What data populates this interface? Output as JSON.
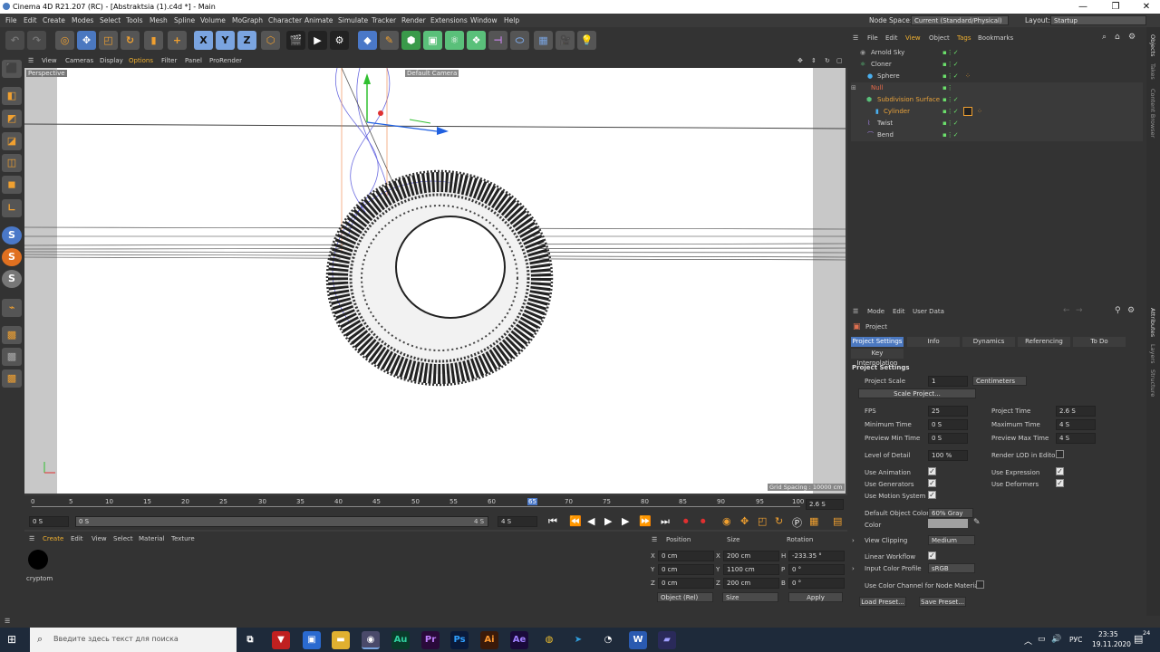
{
  "window": {
    "title": "Cinema 4D R21.207 (RC) - [Abstraktsia (1).c4d *] - Main",
    "minimize": "—",
    "maximize": "❐",
    "close": "✕"
  },
  "menubar": {
    "items": [
      "File",
      "Edit",
      "Create",
      "Modes",
      "Select",
      "Tools",
      "Mesh",
      "Spline",
      "Volume",
      "MoGraph",
      "Character",
      "Animate",
      "Simulate",
      "Tracker",
      "Render",
      "Extensions",
      "Window",
      "Help"
    ],
    "node_space_label": "Node Space:",
    "node_space_value": "Current (Standard/Physical)",
    "layout_label": "Layout:",
    "layout_value": "Startup"
  },
  "toolbar": {
    "axis_x": "X",
    "axis_y": "Y",
    "axis_z": "Z"
  },
  "left_tools": {
    "s1": "S",
    "s2": "S",
    "s3": "S"
  },
  "viewport": {
    "menu": [
      "View",
      "Cameras",
      "Display",
      "Options",
      "Filter",
      "Panel",
      "ProRender"
    ],
    "label": "Perspective",
    "camera": "Default Camera",
    "grid_spacing": "Grid Spacing : 10000 cm"
  },
  "timeline": {
    "ticks": [
      "0",
      "5",
      "10",
      "15",
      "20",
      "25",
      "30",
      "35",
      "40",
      "45",
      "50",
      "55",
      "60",
      "65",
      "70",
      "75",
      "80",
      "85",
      "90",
      "95",
      "100"
    ],
    "current_frame": "2.6 S"
  },
  "transport": {
    "start": "0 S",
    "min": "0 S",
    "max_label": "4 S",
    "end": "4 S"
  },
  "material_manager": {
    "menu": [
      "Create",
      "Edit",
      "View",
      "Select",
      "Material",
      "Texture"
    ],
    "materials": [
      {
        "name": "cryptom"
      }
    ]
  },
  "coord_manager": {
    "headers": {
      "position": "Position",
      "size": "Size",
      "rotation": "Rotation"
    },
    "rows": [
      {
        "axis": "X",
        "pos": "0 cm",
        "saxis": "X",
        "size": "200 cm",
        "raxis": "H",
        "rot": "-233.35 °"
      },
      {
        "axis": "Y",
        "pos": "0 cm",
        "saxis": "Y",
        "size": "1100 cm",
        "raxis": "P",
        "rot": "0 °"
      },
      {
        "axis": "Z",
        "pos": "0 cm",
        "saxis": "Z",
        "size": "200 cm",
        "raxis": "B",
        "rot": "0 °"
      }
    ],
    "mode": "Object (Rel)",
    "size_mode": "Size",
    "apply": "Apply"
  },
  "object_manager": {
    "menu": [
      "File",
      "Edit",
      "View",
      "Object",
      "Tags",
      "Bookmarks"
    ],
    "objects": [
      {
        "name": "Arnold Sky",
        "indent": 0,
        "color": "#cfcfcf"
      },
      {
        "name": "Cloner",
        "indent": 0,
        "color": "#cfcfcf"
      },
      {
        "name": "Sphere",
        "indent": 1,
        "color": "#cfcfcf"
      },
      {
        "name": "Null",
        "indent": 0,
        "color": "#e86a4a"
      },
      {
        "name": "Subdivision Surface",
        "indent": 1,
        "color": "#e8a23a"
      },
      {
        "name": "Cylinder",
        "indent": 2,
        "color": "#e8a23a"
      },
      {
        "name": "Twist",
        "indent": 1,
        "color": "#cfcfcf"
      },
      {
        "name": "Bend",
        "indent": 1,
        "color": "#cfcfcf"
      }
    ]
  },
  "attr_manager": {
    "menu": [
      "Mode",
      "Edit",
      "User Data"
    ],
    "object_name": "Project",
    "tabs": [
      "Project Settings",
      "Info",
      "Dynamics",
      "Referencing",
      "To Do"
    ],
    "tab2": "Key Interpolation",
    "section": "Project Settings",
    "project_scale_label": "Project Scale",
    "project_scale_value": "1",
    "project_scale_unit": "Centimeters",
    "scale_project_btn": "Scale Project...",
    "fps_label": "FPS",
    "fps_value": "25",
    "project_time_label": "Project Time",
    "project_time_value": "2.6 S",
    "min_time_label": "Minimum Time",
    "min_time_value": "0 S",
    "max_time_label": "Maximum Time",
    "max_time_value": "4 S",
    "prev_min_label": "Preview Min Time",
    "prev_min_value": "0 S",
    "prev_max_label": "Preview Max Time",
    "prev_max_value": "4 S",
    "lod_label": "Level of Detail",
    "lod_value": "100 %",
    "render_lod_label": "Render LOD in Editor",
    "use_animation": "Use Animation",
    "use_expression": "Use Expression",
    "use_generators": "Use Generators",
    "use_deformers": "Use Deformers",
    "use_motion": "Use Motion System",
    "default_color_label": "Default Object Color",
    "default_color_value": "60% Gray",
    "color_label": "Color",
    "view_clipping_label": "View Clipping",
    "view_clipping_value": "Medium",
    "linear_workflow": "Linear Workflow",
    "input_color_label": "Input Color Profile",
    "input_color_value": "sRGB",
    "node_material_label": "Use Color Channel for Node Material",
    "load_preset": "Load Preset...",
    "save_preset": "Save Preset..."
  },
  "right_tabs": [
    "Objects",
    "Takes",
    "Content Browser",
    "Attributes",
    "Layers",
    "Structure"
  ],
  "taskbar": {
    "search_placeholder": "Введите здесь текст для поиска",
    "lang": "РУС",
    "time": "23:35",
    "date": "19.11.2020",
    "notif": "24"
  }
}
